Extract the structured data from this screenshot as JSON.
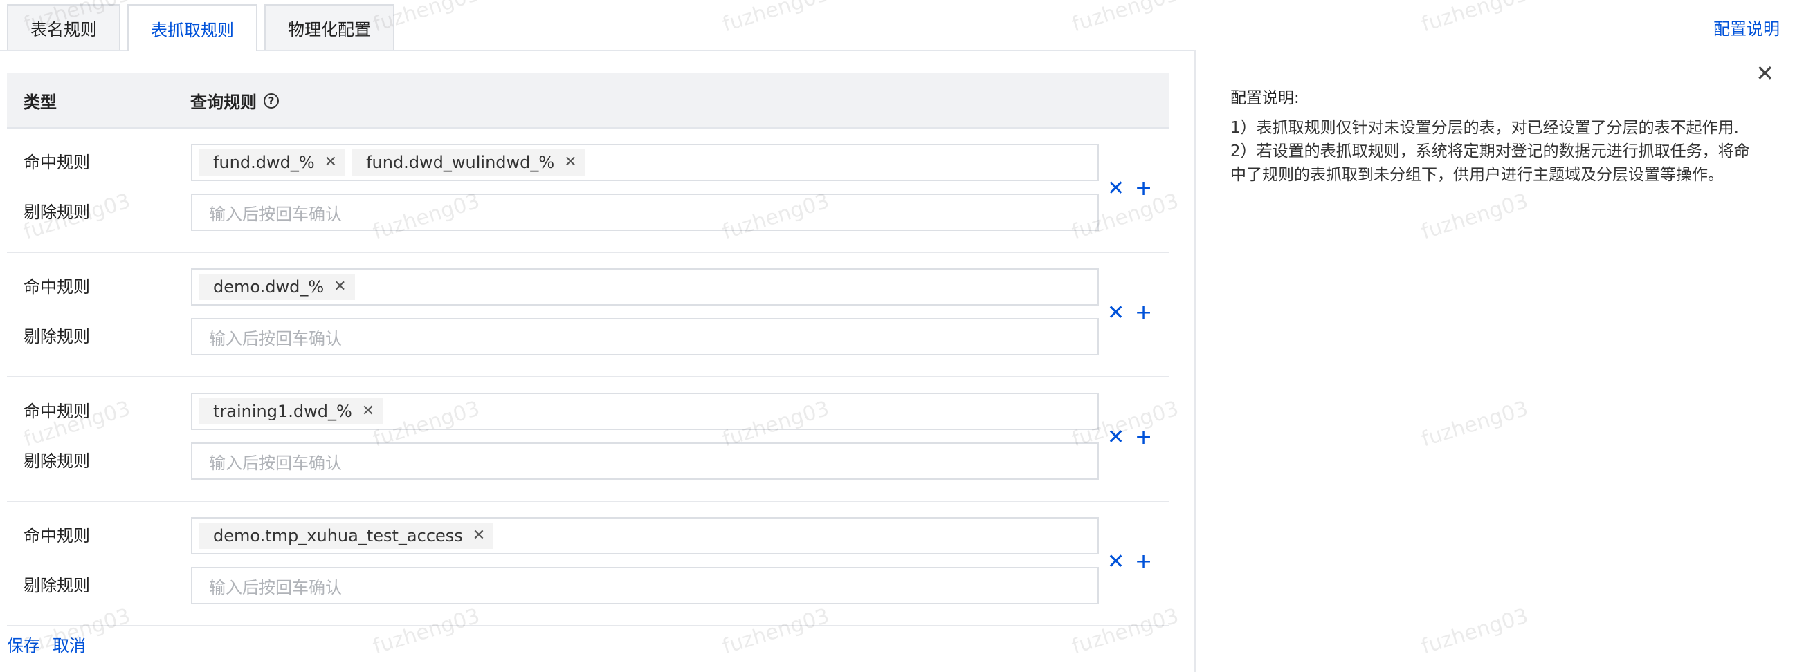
{
  "tabs": [
    {
      "label": "表名规则",
      "active": false
    },
    {
      "label": "表抓取规则",
      "active": true
    },
    {
      "label": "物理化配置",
      "active": false
    }
  ],
  "top_link": "配置说明",
  "table": {
    "header": {
      "type": "类型",
      "query": "查询规则"
    },
    "hit_label": "命中规则",
    "exclude_label": "剔除规则",
    "placeholder": "输入后按回车确认",
    "rows": [
      {
        "hit_tags": [
          "fund.dwd_%",
          "fund.dwd_wulindwd_%"
        ]
      },
      {
        "hit_tags": [
          "demo.dwd_%"
        ]
      },
      {
        "hit_tags": [
          "training1.dwd_%"
        ]
      },
      {
        "hit_tags": [
          "demo.tmp_xuhua_test_access"
        ]
      }
    ]
  },
  "footer": {
    "save": "保存",
    "cancel": "取消"
  },
  "panel": {
    "title": "配置说明:",
    "lines": [
      "1）表抓取规则仅针对未设置分层的表，对已经设置了分层的表不起作用.",
      "2）若设置的表抓取规则，系统将定期对登记的数据元进行抓取任务，将命中了规则的表抓取到未分组下，供用户进行主题域及分层设置等操作。"
    ]
  },
  "watermark": "fuzheng03",
  "icons": {
    "help": "question-circle-icon",
    "remove": "close-icon",
    "add": "plus-icon"
  },
  "colors": {
    "accent": "#0052d9",
    "header_bg": "#f1f2f4"
  }
}
